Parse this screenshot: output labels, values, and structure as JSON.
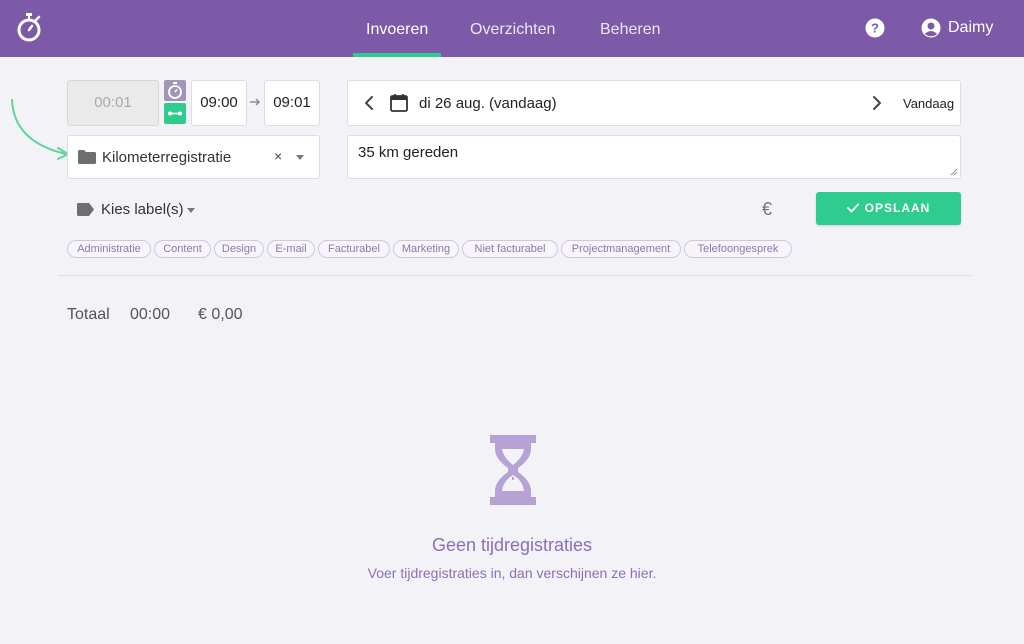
{
  "nav": {
    "items": [
      "Invoeren",
      "Overzichten",
      "Beheren"
    ],
    "active": "Invoeren",
    "user": "Daimy"
  },
  "entry": {
    "duration": "00:01",
    "start": "09:00",
    "end": "09:01",
    "project": "Kilometerregistratie",
    "clear": "×",
    "date": "di 26 aug. (vandaag)",
    "today": "Vandaag",
    "description": "35 km gereden",
    "label_picker": "Kies label(s)",
    "currency": "€",
    "save": "OPSLAAN"
  },
  "labels": [
    "Administratie",
    "Content",
    "Design",
    "E-mail",
    "Facturabel",
    "Marketing",
    "Niet facturabel",
    "Projectmanagement",
    "Telefoongesprek"
  ],
  "totals": {
    "label": "Totaal",
    "time": "00:00",
    "amount": "€ 0,00"
  },
  "empty": {
    "title": "Geen tijdregistraties",
    "subtitle": "Voer tijdregistraties in, dan verschijnen ze hier."
  },
  "colors": {
    "brand": "#7c5aa8",
    "accent": "#2ecc8f",
    "empty_text": "#8b6fb8"
  }
}
